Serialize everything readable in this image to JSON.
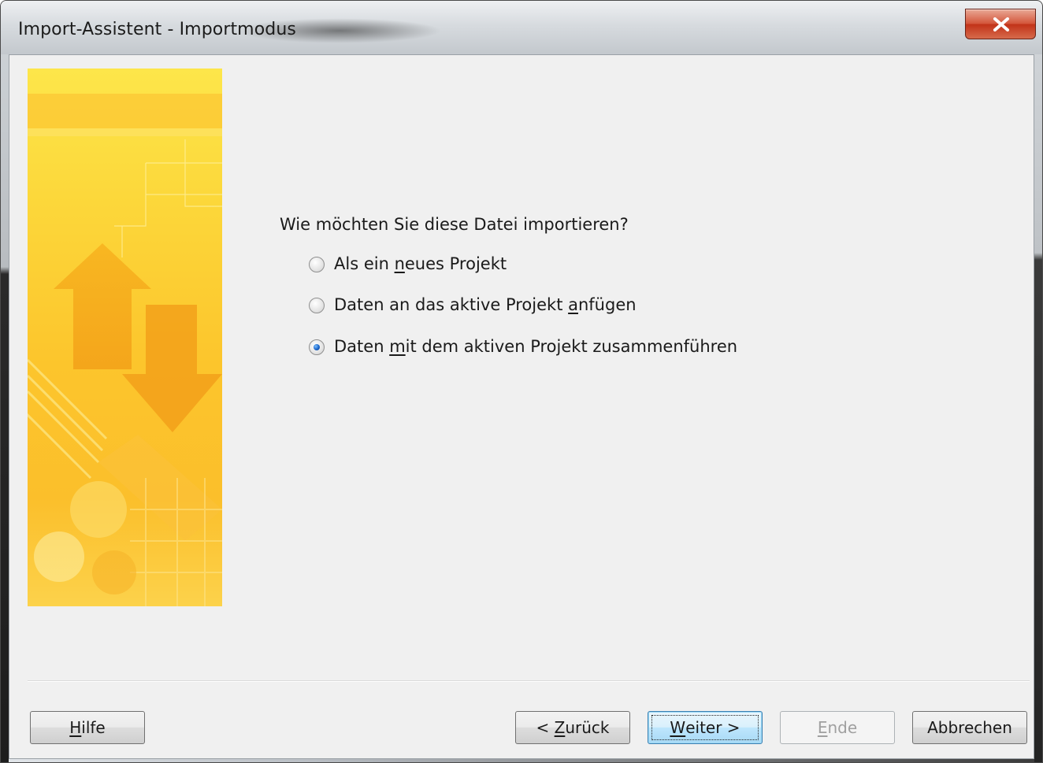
{
  "window": {
    "title": "Import-Assistent - Importmodus",
    "close_label": "X"
  },
  "question": "Wie möchten Sie diese Datei importieren?",
  "options": [
    {
      "pre": "Als ein ",
      "mnemonic": "n",
      "post": "eues Projekt",
      "selected": false
    },
    {
      "pre": "Daten an das aktive Projekt ",
      "mnemonic": "a",
      "post": "nfügen",
      "selected": false
    },
    {
      "pre": "Daten ",
      "mnemonic": "m",
      "post": "it dem aktiven Projekt zusammenführen",
      "selected": true
    }
  ],
  "buttons": {
    "help": {
      "pre": "",
      "mnemonic": "H",
      "post": "ilfe"
    },
    "back": {
      "pre": "< ",
      "mnemonic": "Z",
      "post": "urück"
    },
    "next": {
      "pre": "",
      "mnemonic": "W",
      "post": "eiter >"
    },
    "finish": {
      "pre": "",
      "mnemonic": "E",
      "post": "nde"
    },
    "cancel": {
      "label": "Abbrechen"
    }
  },
  "colors": {
    "banner_yellow": "#fcd23a",
    "banner_orange": "#f6a51b",
    "radio_selected": "#1a64c8"
  }
}
